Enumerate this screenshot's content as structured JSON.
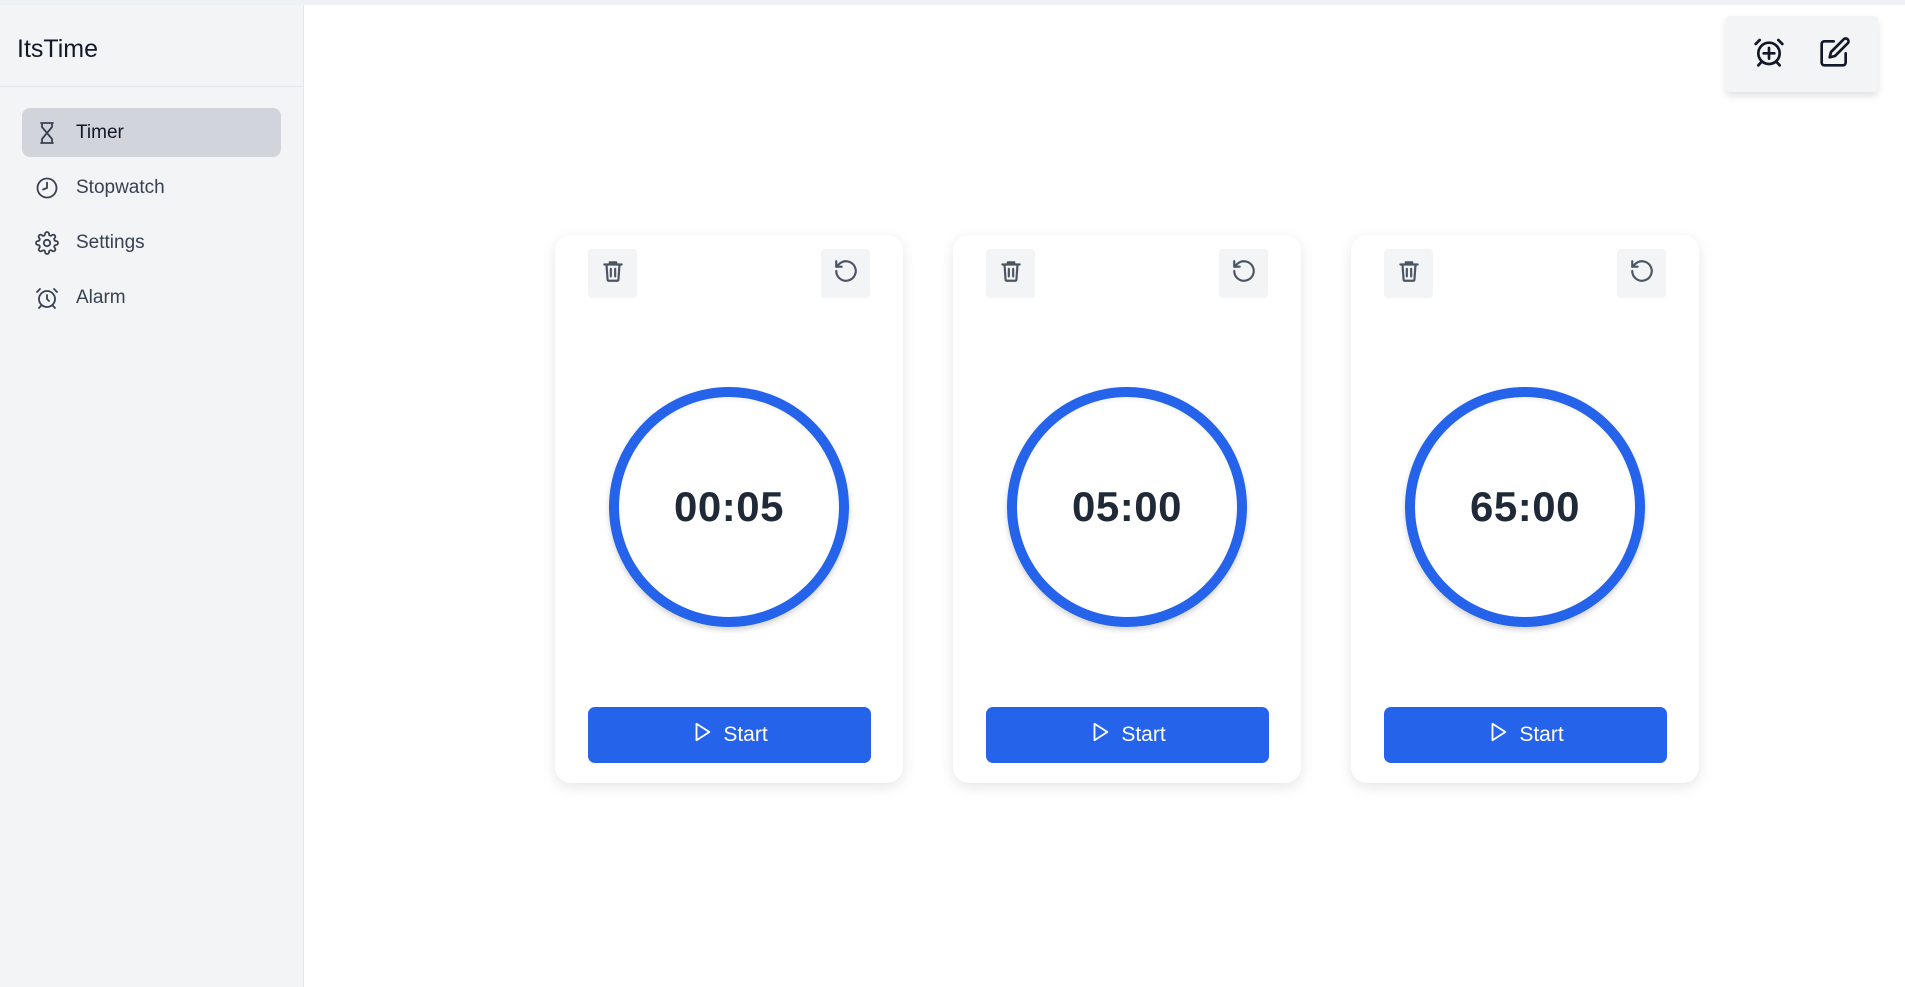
{
  "app": {
    "title": "ItsTime"
  },
  "sidebar": {
    "items": [
      {
        "label": "Timer",
        "icon": "hourglass-icon",
        "active": true
      },
      {
        "label": "Stopwatch",
        "icon": "clock-icon",
        "active": false
      },
      {
        "label": "Settings",
        "icon": "gear-icon",
        "active": false
      },
      {
        "label": "Alarm",
        "icon": "alarm-clock-icon",
        "active": false
      }
    ]
  },
  "toolbar": {
    "icons": [
      "add-alarm-icon",
      "edit-icon"
    ]
  },
  "timers": [
    {
      "time": "00:05",
      "start_label": "Start"
    },
    {
      "time": "05:00",
      "start_label": "Start"
    },
    {
      "time": "65:00",
      "start_label": "Start"
    }
  ],
  "colors": {
    "accent": "#2563eb",
    "active_nav": "#d1d5db",
    "sidebar_bg": "#f3f4f6"
  }
}
